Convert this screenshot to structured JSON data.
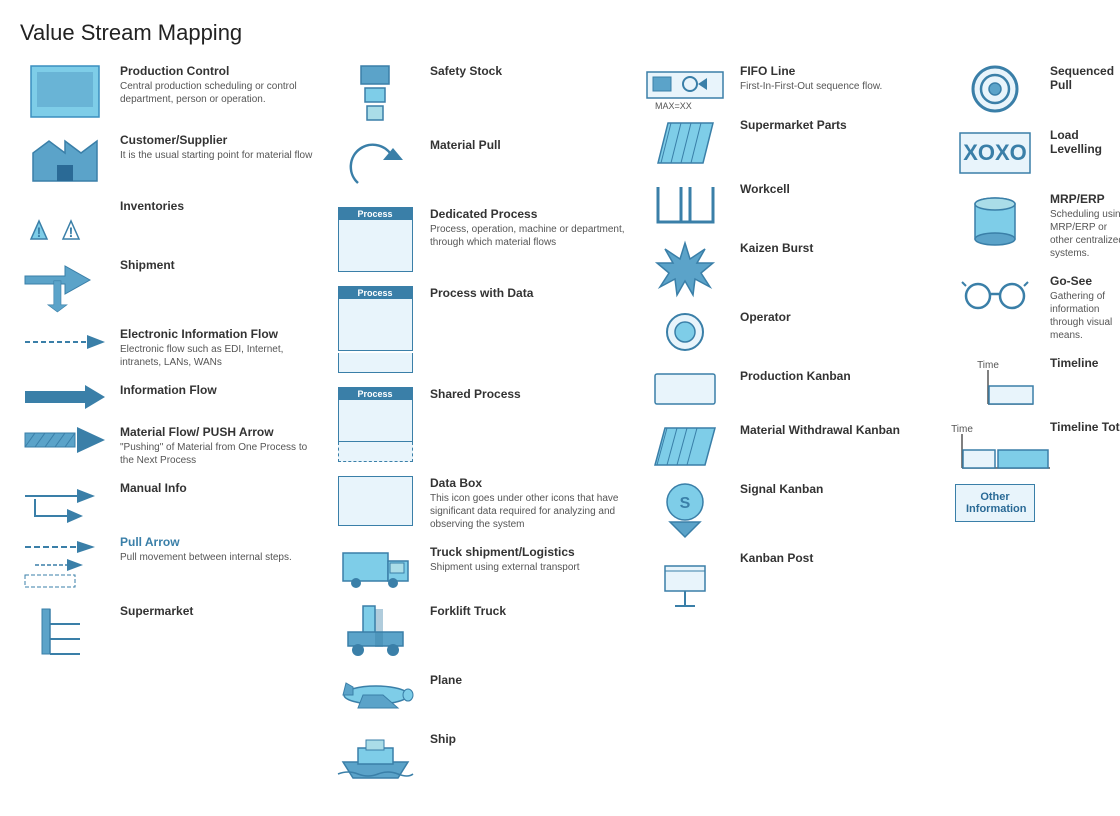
{
  "title": "Value Stream Mapping",
  "columns": [
    {
      "items": [
        {
          "name": "production-control",
          "title": "Production Control",
          "desc": "Central production scheduling or control department, person or operation.",
          "icon_type": "production_control"
        },
        {
          "name": "customer-supplier",
          "title": "Customer/Supplier",
          "desc": "It is the usual starting point for material flow",
          "icon_type": "factory"
        },
        {
          "name": "inventories",
          "title": "Inventories",
          "desc": "",
          "icon_type": "inventories"
        },
        {
          "name": "shipment",
          "title": "Shipment",
          "desc": "",
          "icon_type": "shipment_arrow"
        },
        {
          "name": "electronic-info-flow",
          "title": "Electronic Information Flow",
          "desc": "Electronic flow such as EDI, Internet, intranets, LANs, WANs",
          "icon_type": "electronic_arrow"
        },
        {
          "name": "information-flow",
          "title": "Information Flow",
          "desc": "",
          "icon_type": "info_arrow"
        },
        {
          "name": "material-flow-push",
          "title": "Material Flow/ PUSH Arrow",
          "desc": "\"Pushing\" of Material from One Process to the Next Process",
          "icon_type": "push_arrow"
        },
        {
          "name": "manual-info",
          "title": "Manual Info",
          "desc": "",
          "icon_type": "manual_info"
        },
        {
          "name": "pull-arrow",
          "title": "Pull Arrow",
          "desc": "Pull movement between internal steps.",
          "icon_type": "pull_arrow"
        },
        {
          "name": "supermarket",
          "title": "Supermarket",
          "desc": "",
          "icon_type": "supermarket"
        }
      ]
    },
    {
      "items": [
        {
          "name": "safety-stock",
          "title": "Safety Stock",
          "desc": "",
          "icon_type": "safety_stock"
        },
        {
          "name": "material-pull",
          "title": "Material Pull",
          "desc": "",
          "icon_type": "material_pull"
        },
        {
          "name": "dedicated-process",
          "title": "Dedicated Process",
          "desc": "Process, operation, machine or department, through which material flows",
          "icon_type": "dedicated_process"
        },
        {
          "name": "process-with-data",
          "title": "Process with Data",
          "desc": "",
          "icon_type": "process_with_data"
        },
        {
          "name": "shared-process",
          "title": "Shared Process",
          "desc": "",
          "icon_type": "shared_process"
        },
        {
          "name": "data-box",
          "title": "Data Box",
          "desc": "This icon goes under other icons that have significant data required for analyzing and observing the system",
          "icon_type": "data_box"
        },
        {
          "name": "truck-shipment",
          "title": "Truck shipment/Logistics",
          "desc": "Shipment using external transport",
          "icon_type": "truck"
        },
        {
          "name": "forklift-truck",
          "title": "Forklift Truck",
          "desc": "",
          "icon_type": "forklift"
        },
        {
          "name": "plane",
          "title": "Plane",
          "desc": "",
          "icon_type": "plane"
        },
        {
          "name": "ship",
          "title": "Ship",
          "desc": "",
          "icon_type": "ship"
        }
      ]
    },
    {
      "items": [
        {
          "name": "fifo-line",
          "title": "FIFO Line",
          "desc": "First-In-First-Out sequence flow.",
          "icon_type": "fifo"
        },
        {
          "name": "supermarket-parts",
          "title": "Supermarket Parts",
          "desc": "",
          "icon_type": "supermarket_parts"
        },
        {
          "name": "workcell",
          "title": "Workcell",
          "desc": "",
          "icon_type": "workcell"
        },
        {
          "name": "kaizen-burst",
          "title": "Kaizen Burst",
          "desc": "",
          "icon_type": "kaizen_burst"
        },
        {
          "name": "operator",
          "title": "Operator",
          "desc": "",
          "icon_type": "operator"
        },
        {
          "name": "production-kanban",
          "title": "Production Kanban",
          "desc": "",
          "icon_type": "production_kanban"
        },
        {
          "name": "material-withdrawal-kanban",
          "title": "Material Withdrawal Kanban",
          "desc": "",
          "icon_type": "material_kanban"
        },
        {
          "name": "signal-kanban",
          "title": "Signal Kanban",
          "desc": "",
          "icon_type": "signal_kanban"
        },
        {
          "name": "kanban-post",
          "title": "Kanban Post",
          "desc": "",
          "icon_type": "kanban_post"
        }
      ]
    },
    {
      "items": [
        {
          "name": "sequenced-pull",
          "title": "Sequenced Pull",
          "desc": "",
          "icon_type": "sequenced_pull"
        },
        {
          "name": "load-levelling",
          "title": "Load Levelling",
          "desc": "",
          "icon_type": "load_levelling"
        },
        {
          "name": "mrp-erp",
          "title": "MRP/ERP",
          "desc": "Scheduling using MRP/ERP or other centralized systems.",
          "icon_type": "mrp_erp"
        },
        {
          "name": "go-see",
          "title": "Go-See",
          "desc": "Gathering of information through visual means.",
          "icon_type": "go_see"
        },
        {
          "name": "timeline",
          "title": "Timeline",
          "desc": "",
          "icon_type": "timeline"
        },
        {
          "name": "timeline-total",
          "title": "Timeline Total",
          "desc": "",
          "icon_type": "timeline_total"
        },
        {
          "name": "other-information",
          "title": "Other Information",
          "desc": "",
          "icon_type": "other_info"
        }
      ]
    }
  ]
}
